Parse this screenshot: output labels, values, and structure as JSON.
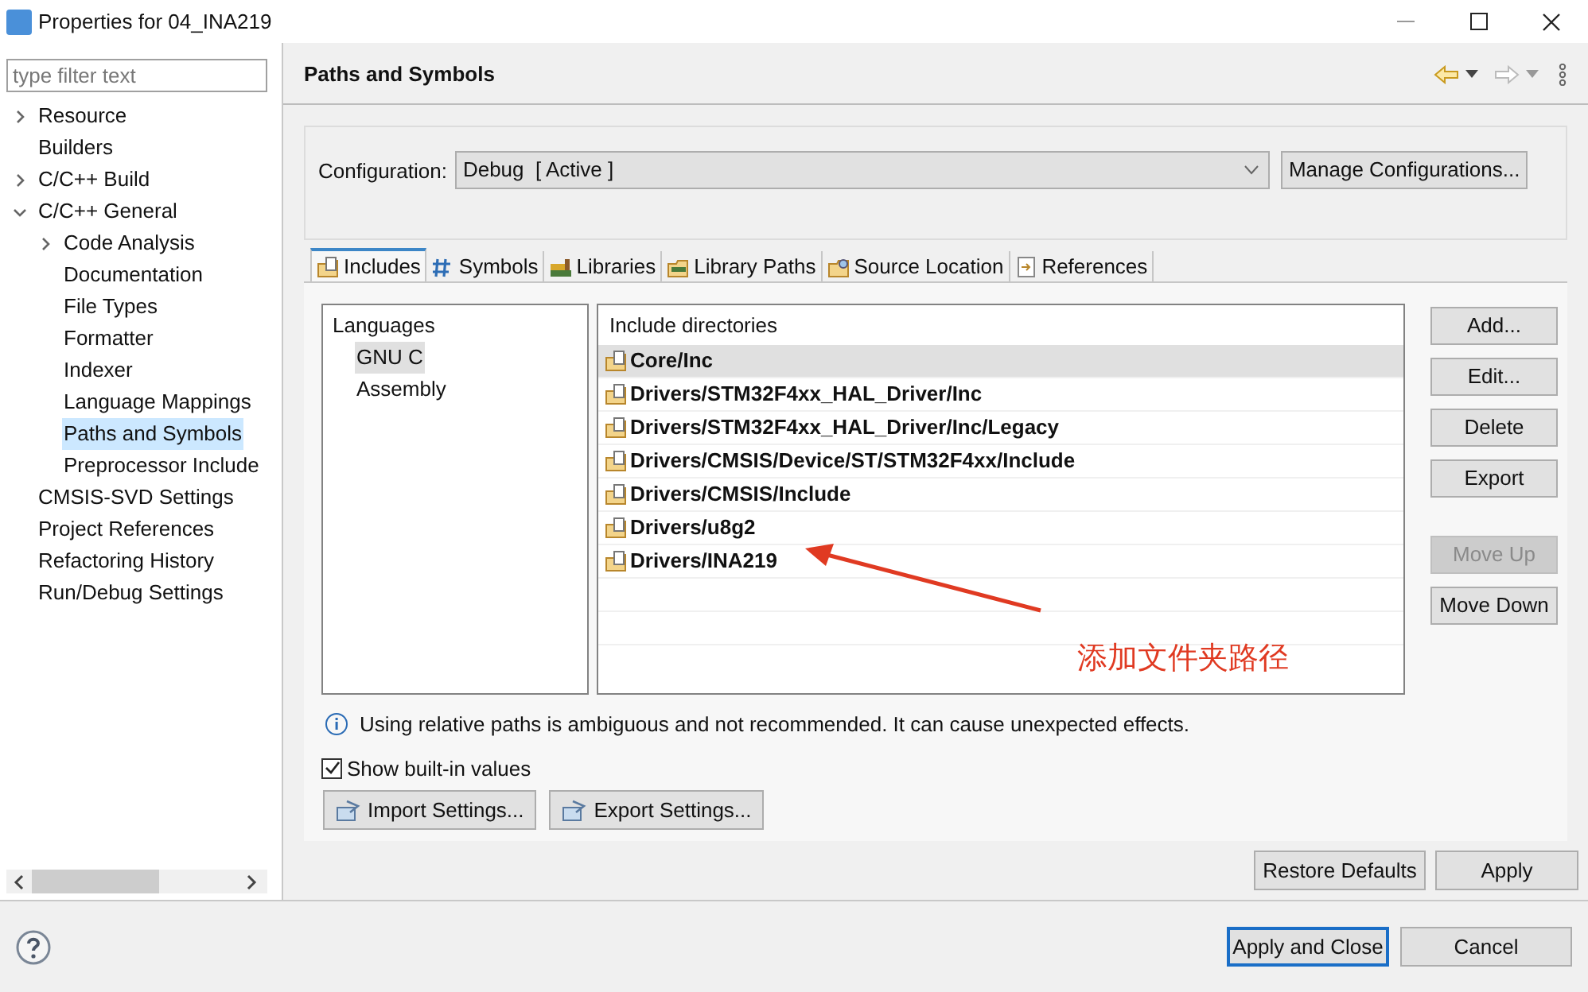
{
  "window": {
    "title": "Properties for 04_INA219"
  },
  "filter": {
    "placeholder": "type filter text"
  },
  "tree": [
    {
      "label": "Resource",
      "kind": "folder",
      "expanded": false,
      "selected": false
    },
    {
      "label": "Builders",
      "kind": "leaf",
      "selected": false
    },
    {
      "label": "C/C++ Build",
      "kind": "folder",
      "expanded": false,
      "selected": false
    },
    {
      "label": "C/C++ General",
      "kind": "folder",
      "expanded": true,
      "selected": false,
      "children": [
        {
          "label": "Code Analysis",
          "kind": "folder",
          "expanded": false,
          "selected": false
        },
        {
          "label": "Documentation",
          "kind": "leaf",
          "selected": false
        },
        {
          "label": "File Types",
          "kind": "leaf",
          "selected": false
        },
        {
          "label": "Formatter",
          "kind": "leaf",
          "selected": false
        },
        {
          "label": "Indexer",
          "kind": "leaf",
          "selected": false
        },
        {
          "label": "Language Mappings",
          "kind": "leaf",
          "selected": false
        },
        {
          "label": "Paths and Symbols",
          "kind": "leaf",
          "selected": true
        },
        {
          "label": "Preprocessor Include",
          "kind": "leaf",
          "selected": false
        }
      ]
    },
    {
      "label": "CMSIS-SVD Settings",
      "kind": "leaf",
      "selected": false
    },
    {
      "label": "Project References",
      "kind": "leaf",
      "selected": false
    },
    {
      "label": "Refactoring History",
      "kind": "leaf",
      "selected": false
    },
    {
      "label": "Run/Debug Settings",
      "kind": "leaf",
      "selected": false
    }
  ],
  "page": {
    "title": "Paths and Symbols",
    "configuration": {
      "label": "Configuration:",
      "value": "Debug  [ Active ]",
      "button": "Manage Configurations..."
    },
    "tabs": [
      {
        "label": "Includes",
        "kind": "includes",
        "selected": true
      },
      {
        "label": "Symbols",
        "kind": "symbols",
        "selected": false
      },
      {
        "label": "Libraries",
        "kind": "libraries",
        "selected": false
      },
      {
        "label": "Library Paths",
        "kind": "library-paths",
        "selected": false
      },
      {
        "label": "Source Location",
        "kind": "source",
        "selected": false
      },
      {
        "label": "References",
        "kind": "references",
        "selected": false
      }
    ],
    "languages": {
      "header": "Languages",
      "items": [
        {
          "label": "GNU C",
          "selected": true
        },
        {
          "label": "Assembly",
          "selected": false
        }
      ]
    },
    "includes": {
      "header": "Include directories",
      "rows": [
        {
          "path": "Core/Inc",
          "selected": true
        },
        {
          "path": "Drivers/STM32F4xx_HAL_Driver/Inc",
          "selected": false
        },
        {
          "path": "Drivers/STM32F4xx_HAL_Driver/Inc/Legacy",
          "selected": false
        },
        {
          "path": "Drivers/CMSIS/Device/ST/STM32F4xx/Include",
          "selected": false
        },
        {
          "path": "Drivers/CMSIS/Include",
          "selected": false
        },
        {
          "path": "Drivers/u8g2",
          "selected": false
        },
        {
          "path": "Drivers/INA219",
          "selected": false
        }
      ]
    },
    "side_buttons": [
      {
        "label": "Add...",
        "disabled": false
      },
      {
        "label": "Edit...",
        "disabled": false
      },
      {
        "label": "Delete",
        "disabled": false
      },
      {
        "label": "Export",
        "disabled": false
      }
    ],
    "move_buttons": [
      {
        "label": "Move Up",
        "disabled": true
      },
      {
        "label": "Move Down",
        "disabled": false
      }
    ],
    "info": "Using relative paths is ambiguous and not recommended. It can cause unexpected effects.",
    "show_builtin": {
      "label": "Show built-in values",
      "checked": true
    },
    "settings_buttons": [
      "Import Settings...",
      "Export Settings..."
    ],
    "annotation": "添加文件夹路径",
    "restore_defaults": "Restore Defaults",
    "apply": "Apply"
  },
  "footer": {
    "apply_close": "Apply and Close",
    "cancel": "Cancel"
  }
}
